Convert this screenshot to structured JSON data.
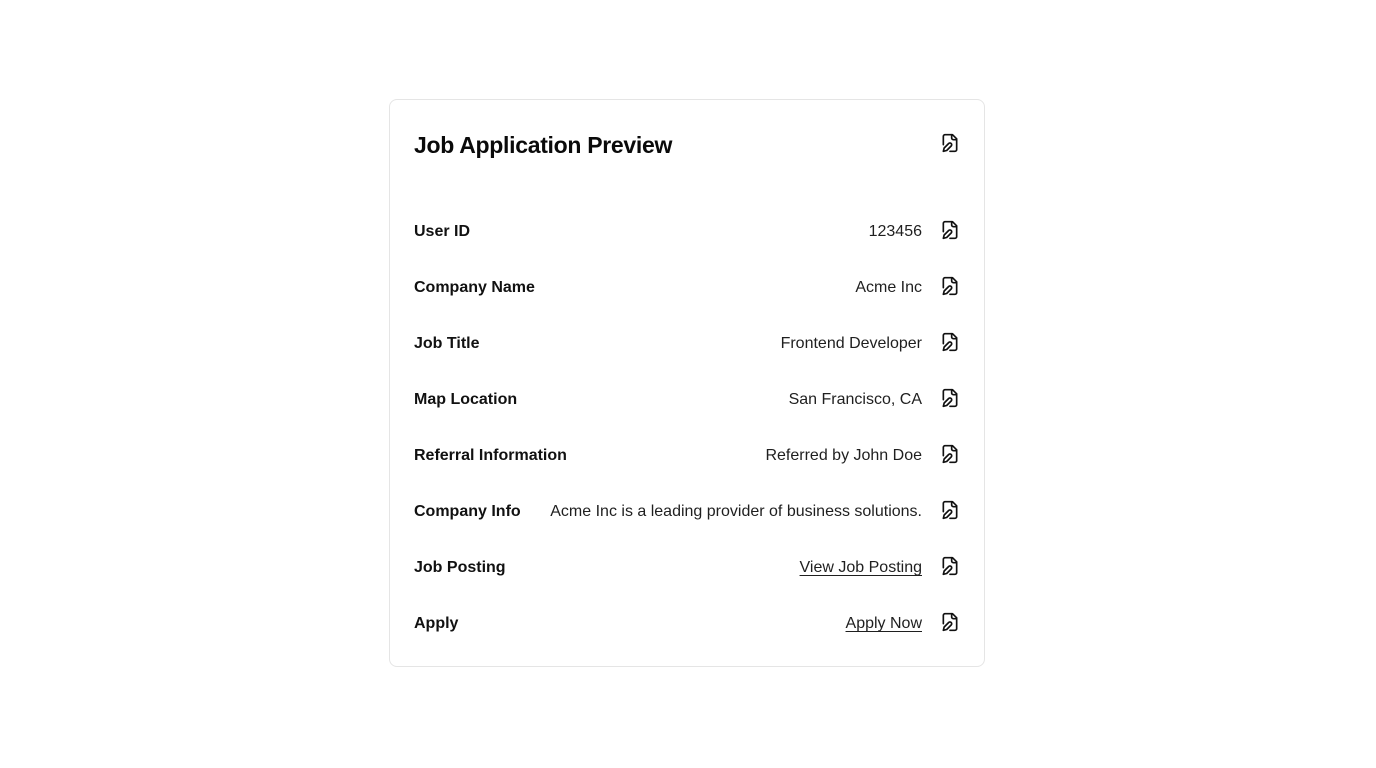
{
  "card": {
    "title": "Job Application Preview",
    "header_icon": "file-edit-icon"
  },
  "rows": [
    {
      "label": "User ID",
      "value": "123456",
      "type": "text",
      "icon": "file-edit-icon"
    },
    {
      "label": "Company Name",
      "value": "Acme Inc",
      "type": "text",
      "icon": "file-edit-icon"
    },
    {
      "label": "Job Title",
      "value": "Frontend Developer",
      "type": "text",
      "icon": "file-edit-icon"
    },
    {
      "label": "Map Location",
      "value": "San Francisco, CA",
      "type": "text",
      "icon": "file-edit-icon"
    },
    {
      "label": "Referral Information",
      "value": "Referred by John Doe",
      "type": "text",
      "icon": "file-edit-icon"
    },
    {
      "label": "Company Info",
      "value": "Acme Inc is a leading provider of business solutions.",
      "type": "text",
      "icon": "file-edit-icon"
    },
    {
      "label": "Job Posting",
      "value": "View Job Posting",
      "type": "link",
      "icon": "file-edit-icon"
    },
    {
      "label": "Apply",
      "value": "Apply Now",
      "type": "link",
      "icon": "file-edit-icon"
    }
  ]
}
